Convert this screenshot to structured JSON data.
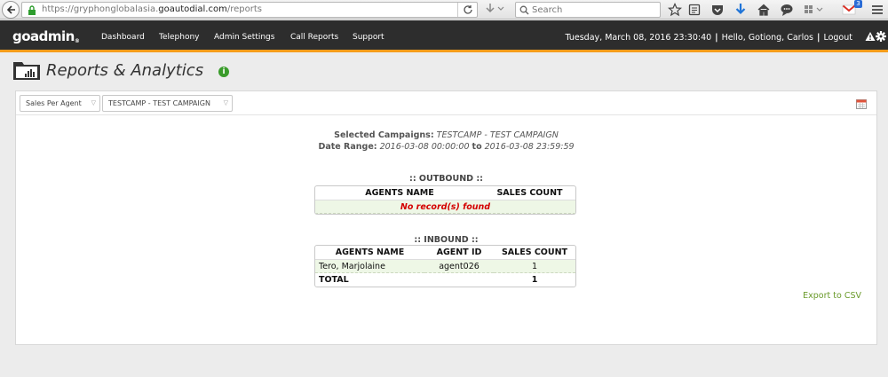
{
  "browser": {
    "url_prefix": "https://gryphonglobalasia.",
    "url_domain": "goautodial.com",
    "url_path": "/reports",
    "search_placeholder": "Search",
    "mail_badge_count": "3"
  },
  "nav": {
    "logo": "goadmin",
    "items": [
      {
        "label": "Dashboard"
      },
      {
        "label": "Telephony"
      },
      {
        "label": "Admin Settings"
      },
      {
        "label": "Call Reports"
      },
      {
        "label": "Support"
      }
    ],
    "datetime": "Tuesday, March 08, 2016 23:30:40",
    "greeting": "Hello, Gotiong, Carlos",
    "logout": "Logout",
    "separator": "|"
  },
  "header": {
    "title": "Reports & Analytics",
    "info": "i"
  },
  "filters": {
    "report_type": "Sales Per Agent",
    "campaign": "TESTCAMP - TEST CAMPAIGN"
  },
  "summary": {
    "campaigns_label": "Selected Campaigns:",
    "campaigns_value": "TESTCAMP - TEST CAMPAIGN",
    "range_label": "Date Range:",
    "range_start": "2016-03-08 00:00:00",
    "range_to": "to",
    "range_end": "2016-03-08 23:59:59"
  },
  "outbound": {
    "title": ":: OUTBOUND ::",
    "columns": [
      "AGENTS NAME",
      "SALES COUNT"
    ],
    "empty_message": "No record(s) found"
  },
  "inbound": {
    "title": ":: INBOUND ::",
    "columns": [
      "AGENTS NAME",
      "AGENT ID",
      "SALES COUNT"
    ],
    "rows": [
      {
        "name": "Tero, Marjolaine",
        "agent_id": "agent026",
        "count": "1"
      }
    ],
    "total_label": "TOTAL",
    "total_count": "1"
  },
  "export_label": "Export to CSV",
  "colors": {
    "nav_bg": "#2d2d2d",
    "accent_orange": "#f59c1a",
    "empty_red": "#d40000",
    "export_green": "#6a9a2a",
    "info_green": "#3a9c2b"
  }
}
